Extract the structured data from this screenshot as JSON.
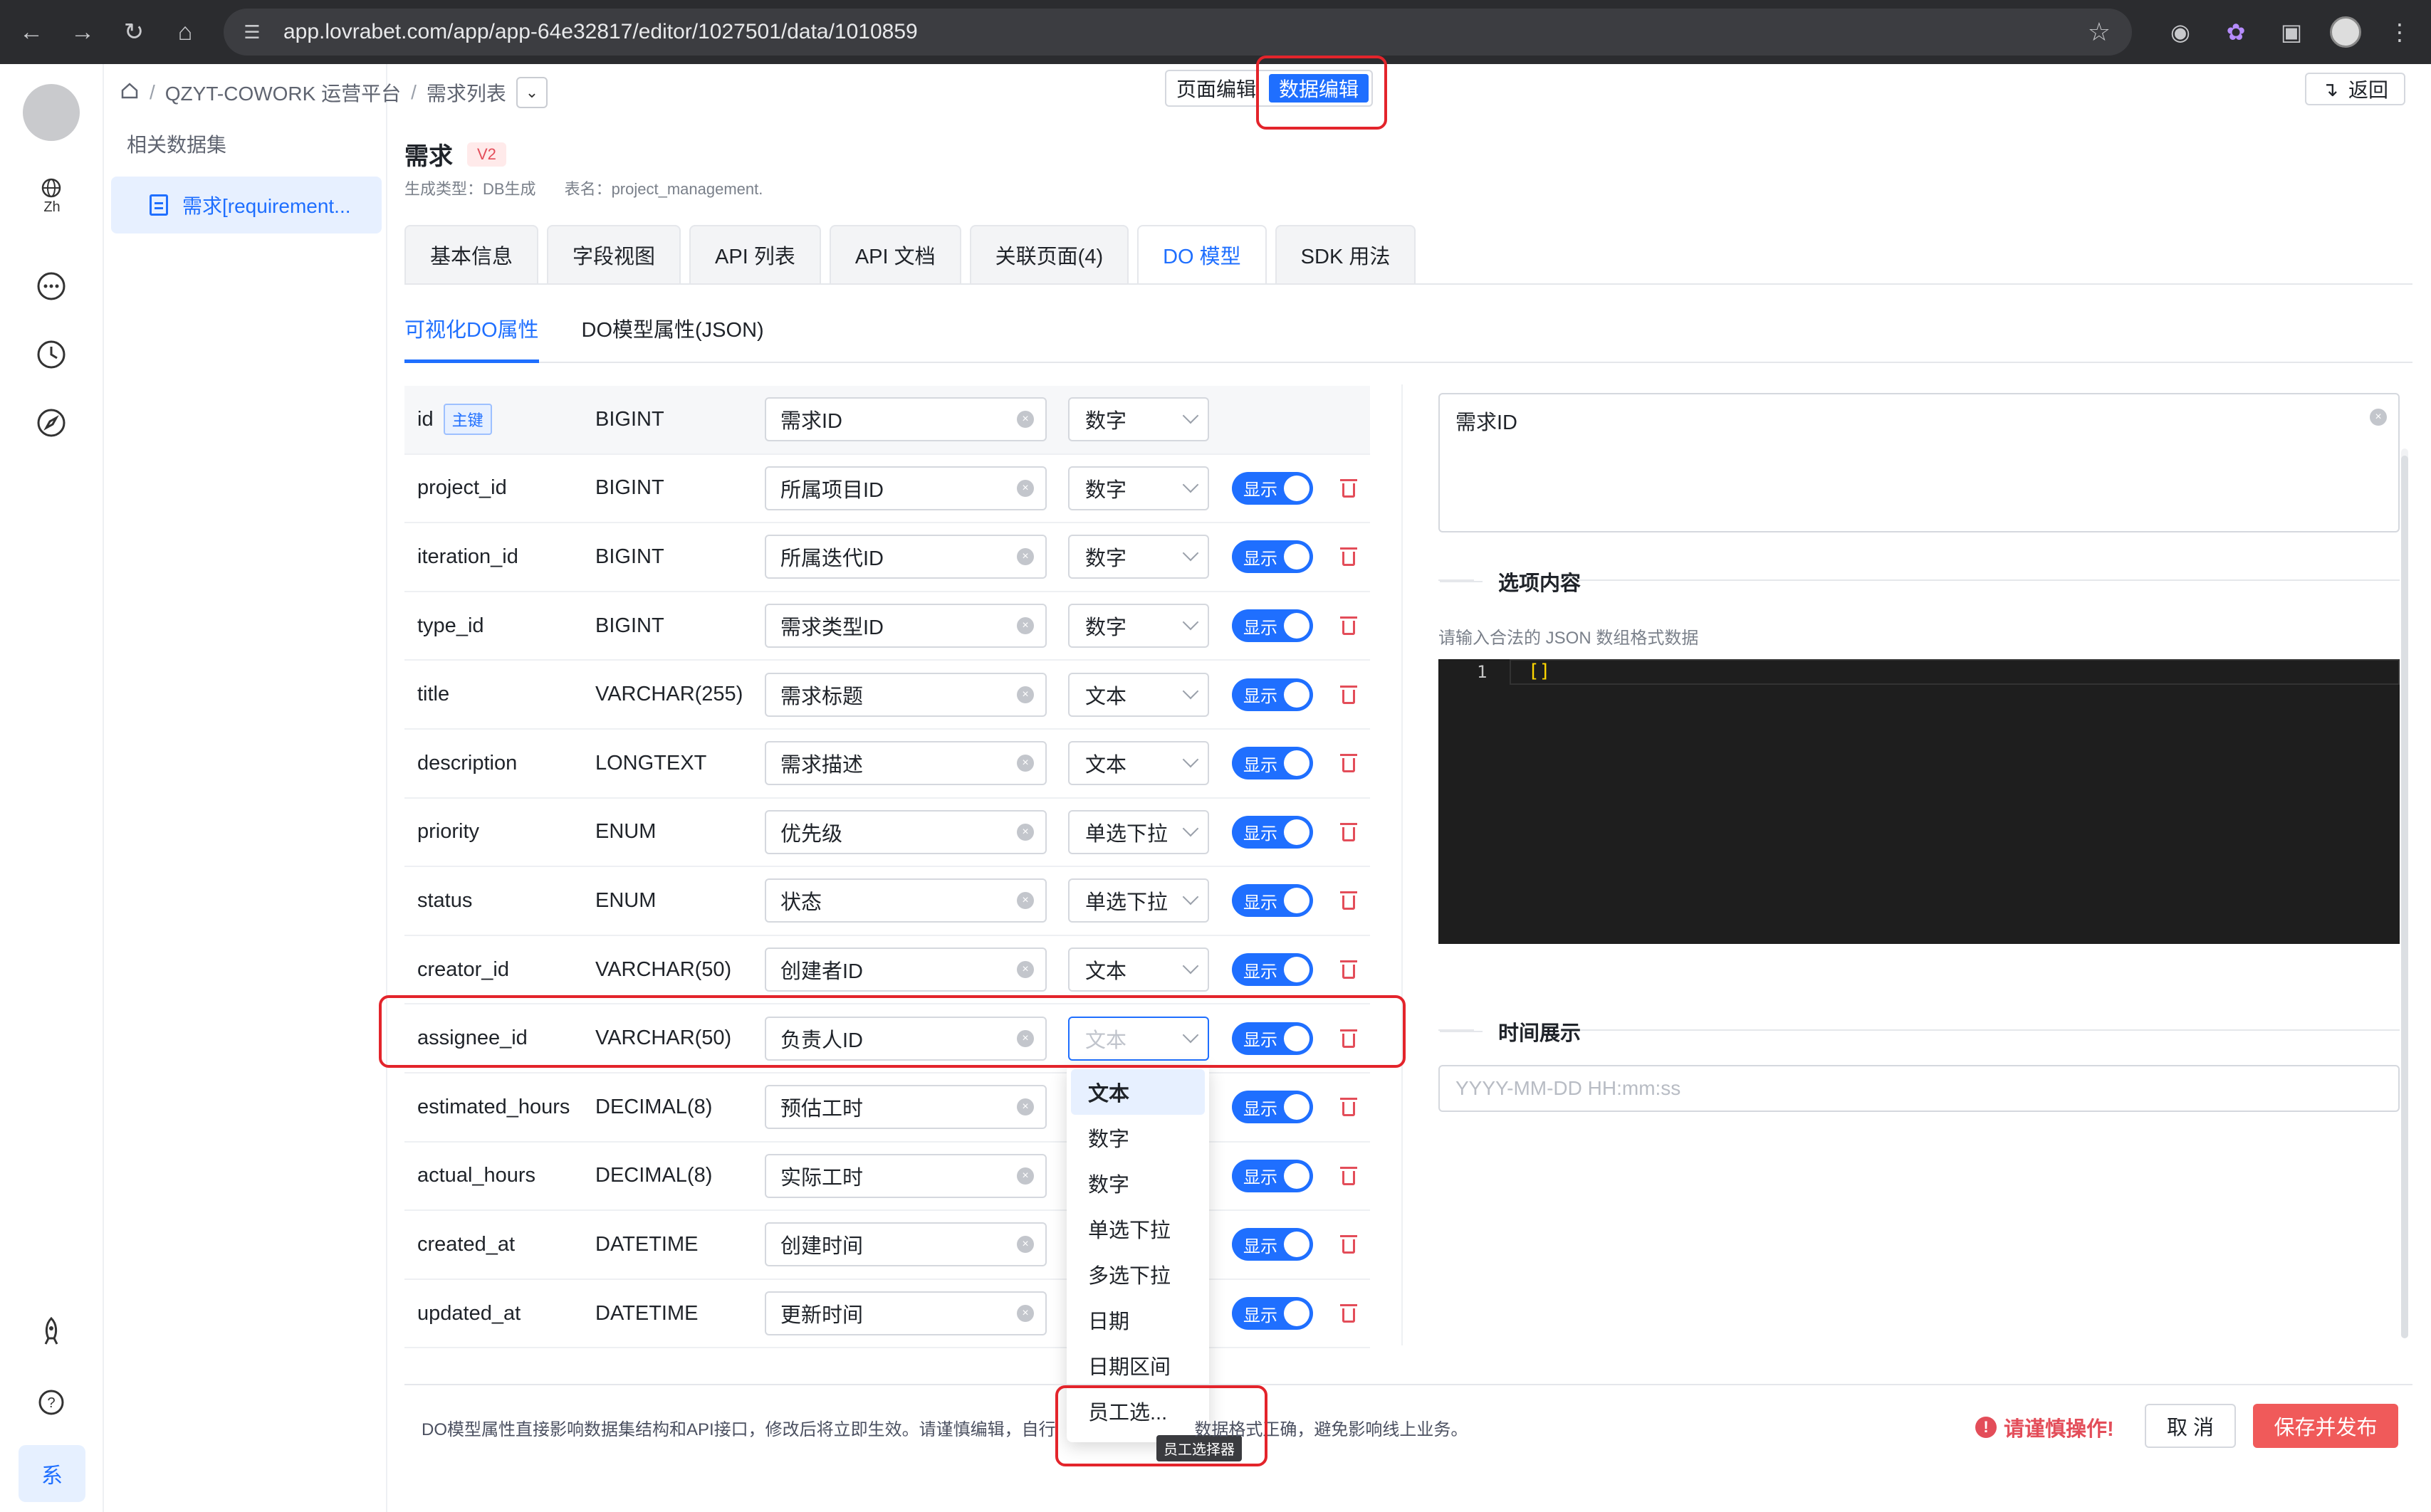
{
  "browser": {
    "url": "app.lovrabet.com/app/app-64e32817/editor/1027501/data/1010859"
  },
  "rail": {
    "lang_label": "Zh",
    "sys_label": "系"
  },
  "breadcrumb": {
    "root": "QZYT-COWORK 运营平台",
    "current": "需求列表",
    "sep": "/"
  },
  "mode": {
    "page_edit": "页面编辑",
    "data_edit": "数据编辑"
  },
  "back_label": "返回",
  "sidebar": {
    "title": "相关数据集",
    "item_label": "需求[requirement..."
  },
  "dataset": {
    "title": "需求",
    "version": "V2",
    "gen_type": "生成类型：DB生成",
    "table_name": "表名：project_management."
  },
  "tabs": [
    "基本信息",
    "字段视图",
    "API 列表",
    "API 文档",
    "关联页面(4)",
    "DO 模型",
    "SDK 用法"
  ],
  "active_tab": "DO 模型",
  "subtabs": [
    "可视化DO属性",
    "DO模型属性(JSON)"
  ],
  "show_label": "显示",
  "pk_label": "主键",
  "fields": [
    {
      "name": "id",
      "type": "BIGINT",
      "label": "需求ID",
      "widget": "数字"
    },
    {
      "name": "project_id",
      "type": "BIGINT",
      "label": "所属项目ID",
      "widget": "数字"
    },
    {
      "name": "iteration_id",
      "type": "BIGINT",
      "label": "所属迭代ID",
      "widget": "数字"
    },
    {
      "name": "type_id",
      "type": "BIGINT",
      "label": "需求类型ID",
      "widget": "数字"
    },
    {
      "name": "title",
      "type": "VARCHAR(255)",
      "label": "需求标题",
      "widget": "文本"
    },
    {
      "name": "description",
      "type": "LONGTEXT",
      "label": "需求描述",
      "widget": "文本"
    },
    {
      "name": "priority",
      "type": "ENUM",
      "label": "优先级",
      "widget": "单选下拉"
    },
    {
      "name": "status",
      "type": "ENUM",
      "label": "状态",
      "widget": "单选下拉"
    },
    {
      "name": "creator_id",
      "type": "VARCHAR(50)",
      "label": "创建者ID",
      "widget": "文本"
    },
    {
      "name": "assignee_id",
      "type": "VARCHAR(50)",
      "label": "负责人ID",
      "widget": "文本"
    },
    {
      "name": "estimated_hours",
      "type": "DECIMAL(8)",
      "label": "预估工时",
      "widget": ""
    },
    {
      "name": "actual_hours",
      "type": "DECIMAL(8)",
      "label": "实际工时",
      "widget": ""
    },
    {
      "name": "created_at",
      "type": "DATETIME",
      "label": "创建时间",
      "widget": ""
    },
    {
      "name": "updated_at",
      "type": "DATETIME",
      "label": "更新时间",
      "widget": ""
    }
  ],
  "dropdown": {
    "options": [
      "文本",
      "数字",
      "数字",
      "单选下拉",
      "多选下拉",
      "日期",
      "日期区间",
      "员工选..."
    ],
    "selected": "文本",
    "tooltip": "员工选择器"
  },
  "right_panel": {
    "desc_value": "需求ID",
    "options_title": "选项内容",
    "options_hint": "请输入合法的 JSON 数组格式数据",
    "code_line_no": "1",
    "code_value": "[]",
    "time_title": "时间展示",
    "time_placeholder": "YYYY-MM-DD HH:mm:ss"
  },
  "footer": {
    "note": "DO模型属性直接影响数据集结构和API接口，修改后将立即生效。请谨慎编辑，自行",
    "note_tail": "数据格式正确，避免影响线上业务。",
    "warning": "请谨慎操作!",
    "cancel": "取 消",
    "save": "保存并发布"
  },
  "colors": {
    "accent": "#1f6fff",
    "danger": "#e34d59",
    "annotation": "#e3242b"
  }
}
